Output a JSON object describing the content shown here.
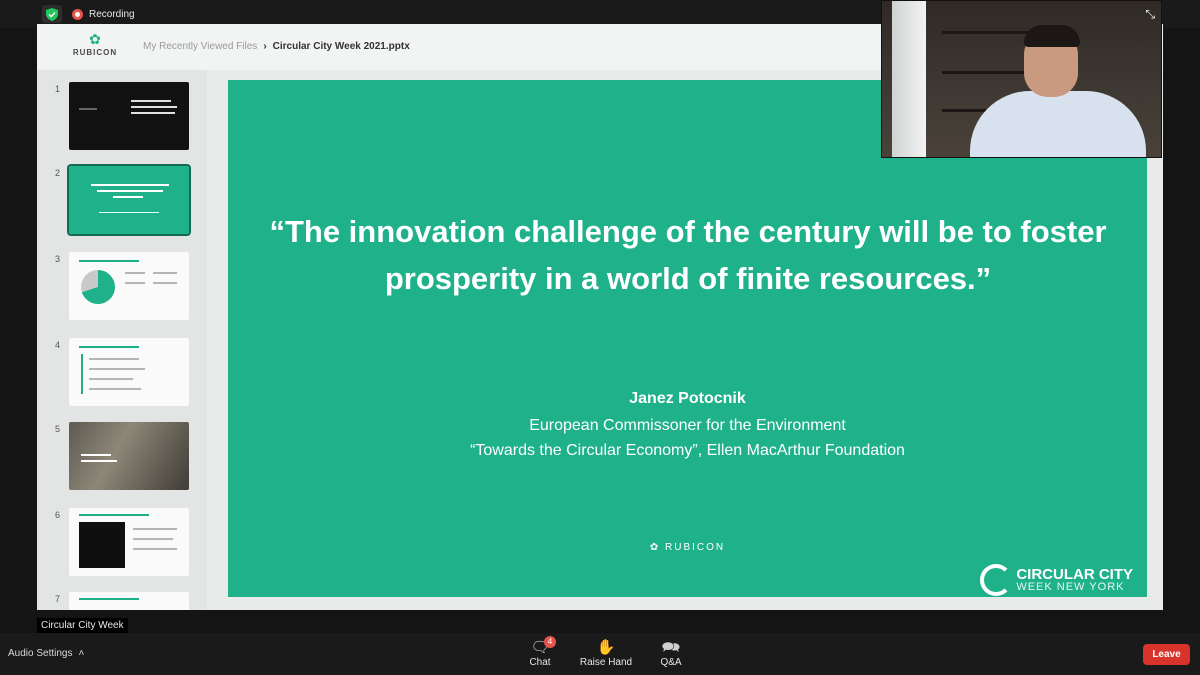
{
  "topbar": {
    "shield_icon": "shield-check-icon",
    "recording_label": "Recording",
    "recording_color": "#e5534b"
  },
  "presentation": {
    "logo_text": "RUBICON",
    "breadcrumb": {
      "parent": "My Recently Viewed Files",
      "current": "Circular City Week 2021.pptx"
    },
    "thumbnails": [
      {
        "number": "1"
      },
      {
        "number": "2",
        "selected": true
      },
      {
        "number": "3"
      },
      {
        "number": "4"
      },
      {
        "number": "5"
      },
      {
        "number": "6"
      },
      {
        "number": "7"
      }
    ],
    "slide": {
      "background": "#1fb28a",
      "quote": "“The innovation challenge of the century will be to foster prosperity in a world of finite resources.”",
      "author": "Janez Potocnik",
      "role": "European Commissoner  for the Environment",
      "source": "“Towards the Circular Economy”, Ellen MacArthur Foundation",
      "logo_text": "RUBICON",
      "event_logo_line1": "CIRCULAR CITY",
      "event_logo_line2": "WEEK NEW YORK"
    }
  },
  "video": {
    "expand_icon": "expand-arrows-icon"
  },
  "participant_name": "Circular City Week",
  "bottombar": {
    "audio_label": "Audio Settings",
    "chat_label": "Chat",
    "chat_badge": "4",
    "raise_hand_label": "Raise Hand",
    "qa_label": "Q&A",
    "leave_label": "Leave",
    "leave_color": "#d9342b"
  }
}
